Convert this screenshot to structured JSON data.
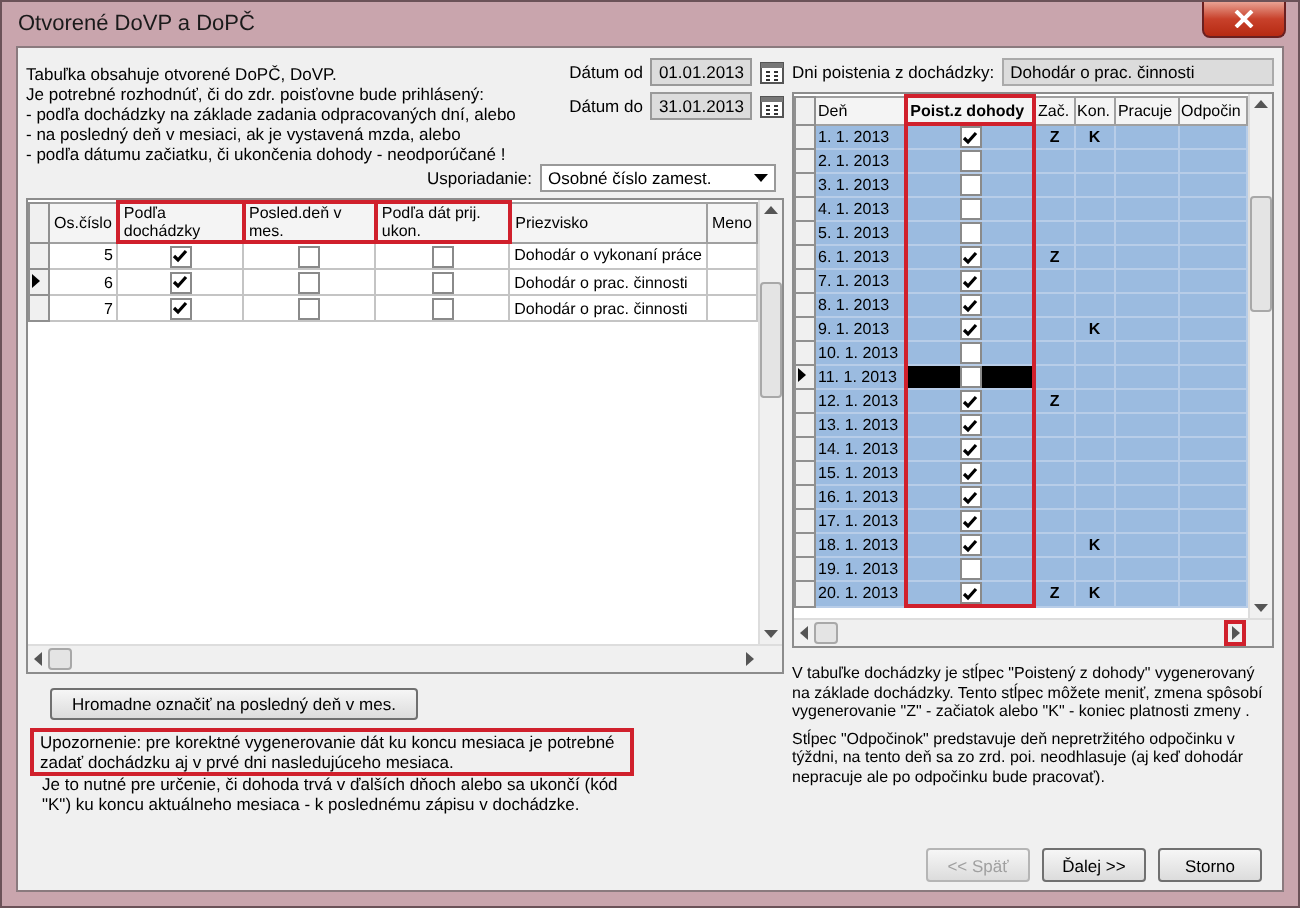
{
  "window": {
    "title": "Otvorené DoVP a DoPČ"
  },
  "intro_lines": [
    "Tabuľka obsahuje otvorené DoPČ, DoVP.",
    "Je potrebné rozhodnúť, či do zdr. poisťovne bude prihlásený:",
    "- podľa dochádzky na základe zadania odpracovaných dní, alebo",
    "- na posledný deň v mesiaci, ak je vystavená mzda, alebo",
    "- podľa dátumu začiatku, či ukončenia dohody - neodporúčané !"
  ],
  "date_from": {
    "label": "Dátum od",
    "value": "01.01.2013"
  },
  "date_to": {
    "label": "Dátum do",
    "value": "31.01.2013"
  },
  "sort": {
    "label": "Usporiadanie:",
    "value": "Osobné číslo zamest."
  },
  "employees_table": {
    "columns": [
      {
        "label": "Os.číslo",
        "highlighted": false
      },
      {
        "label": "Podľa dochádzky",
        "highlighted": true
      },
      {
        "label": "Posled.deň v mes.",
        "highlighted": true
      },
      {
        "label": "Podľa dát prij. ukon.",
        "highlighted": true
      },
      {
        "label": "Priezvisko",
        "highlighted": false
      },
      {
        "label": "Meno",
        "highlighted": false
      }
    ],
    "rows": [
      {
        "number": "5",
        "by_attendance": true,
        "last_day": false,
        "by_dates": false,
        "surname": "Dohodár o vykonaní práce",
        "selected": false
      },
      {
        "number": "6",
        "by_attendance": true,
        "last_day": false,
        "by_dates": false,
        "surname": "Dohodár o prac. činnosti",
        "selected": true
      },
      {
        "number": "7",
        "by_attendance": true,
        "last_day": false,
        "by_dates": false,
        "surname": "Dohodár o prac. činnosti",
        "selected": false
      }
    ]
  },
  "insurance_days": {
    "label": "Dni poistenia z dochádzky:",
    "value": "Dohodár o prac. činnosti"
  },
  "attendance_table": {
    "columns": [
      {
        "label": "Deň",
        "highlighted": false
      },
      {
        "label": "Poist.z dohody",
        "highlighted": true
      },
      {
        "label": "Zač.",
        "highlighted": false
      },
      {
        "label": "Kon.",
        "highlighted": false
      },
      {
        "label": "Pracuje",
        "highlighted": false
      },
      {
        "label": "Odpočin",
        "highlighted": false
      }
    ],
    "scroll_right_highlighted": true,
    "rows": [
      {
        "day": "1. 1. 2013",
        "insured": true,
        "start": "Z",
        "end": "K",
        "selected": false
      },
      {
        "day": "2. 1. 2013",
        "insured": false,
        "selected": false
      },
      {
        "day": "3. 1. 2013",
        "insured": false,
        "selected": false
      },
      {
        "day": "4. 1. 2013",
        "insured": false,
        "selected": false
      },
      {
        "day": "5. 1. 2013",
        "insured": false,
        "selected": false
      },
      {
        "day": "6. 1. 2013",
        "insured": true,
        "start": "Z",
        "selected": false
      },
      {
        "day": "7. 1. 2013",
        "insured": true,
        "selected": false
      },
      {
        "day": "8. 1. 2013",
        "insured": true,
        "selected": false
      },
      {
        "day": "9. 1. 2013",
        "insured": true,
        "end": "K",
        "selected": false
      },
      {
        "day": "10. 1. 2013",
        "insured": false,
        "selected": false
      },
      {
        "day": "11. 1. 2013",
        "insured": false,
        "selected": true
      },
      {
        "day": "12. 1. 2013",
        "insured": true,
        "start": "Z",
        "selected": false
      },
      {
        "day": "13. 1. 2013",
        "insured": true,
        "selected": false
      },
      {
        "day": "14. 1. 2013",
        "insured": true,
        "selected": false
      },
      {
        "day": "15. 1. 2013",
        "insured": true,
        "selected": false
      },
      {
        "day": "16. 1. 2013",
        "insured": true,
        "selected": false
      },
      {
        "day": "17. 1. 2013",
        "insured": true,
        "selected": false
      },
      {
        "day": "18. 1. 2013",
        "insured": true,
        "end": "K",
        "selected": false
      },
      {
        "day": "19. 1. 2013",
        "insured": false,
        "selected": false
      },
      {
        "day": "20. 1. 2013",
        "insured": true,
        "start": "Z",
        "end": "K",
        "selected": false
      }
    ]
  },
  "mark_button": "Hromadne označiť na posledný deň v mes.",
  "warning": {
    "text": "Upozornenie: pre korektné vygenerovanie dát ku koncu mesiaca je potrebné zadať dochádzku aj v prvé dni nasledujúceho mesiaca.",
    "highlighted": true
  },
  "note": "Je to nutné pre určenie, či dohoda trvá v ďalších dňoch alebo sa ukončí (kód \"K\") ku koncu aktuálneho mesiaca - k poslednému zápisu v dochádzke.",
  "right_notes": [
    "V tabuľke dochádzky je stĺpec  \"Poistený z dohody\" vygenerovaný na základe dochádzky. Tento stĺpec môžete meniť, zmena spôsobí vygenerovanie \"Z\" - začiatok alebo \"K\" - koniec platnosti zmeny .",
    "Stĺpec \"Odpočinok\" predstavuje deň nepretržitého odpočinku v týždni, na tento deň sa zo zrd. poi. neodhlasuje (aj keď dohodár nepracuje ale po odpočinku bude pracovať)."
  ],
  "buttons": [
    {
      "label": "<< Späť",
      "disabled": true
    },
    {
      "label": "Ďalej >>",
      "disabled": false
    },
    {
      "label": "Storno",
      "disabled": false
    }
  ]
}
